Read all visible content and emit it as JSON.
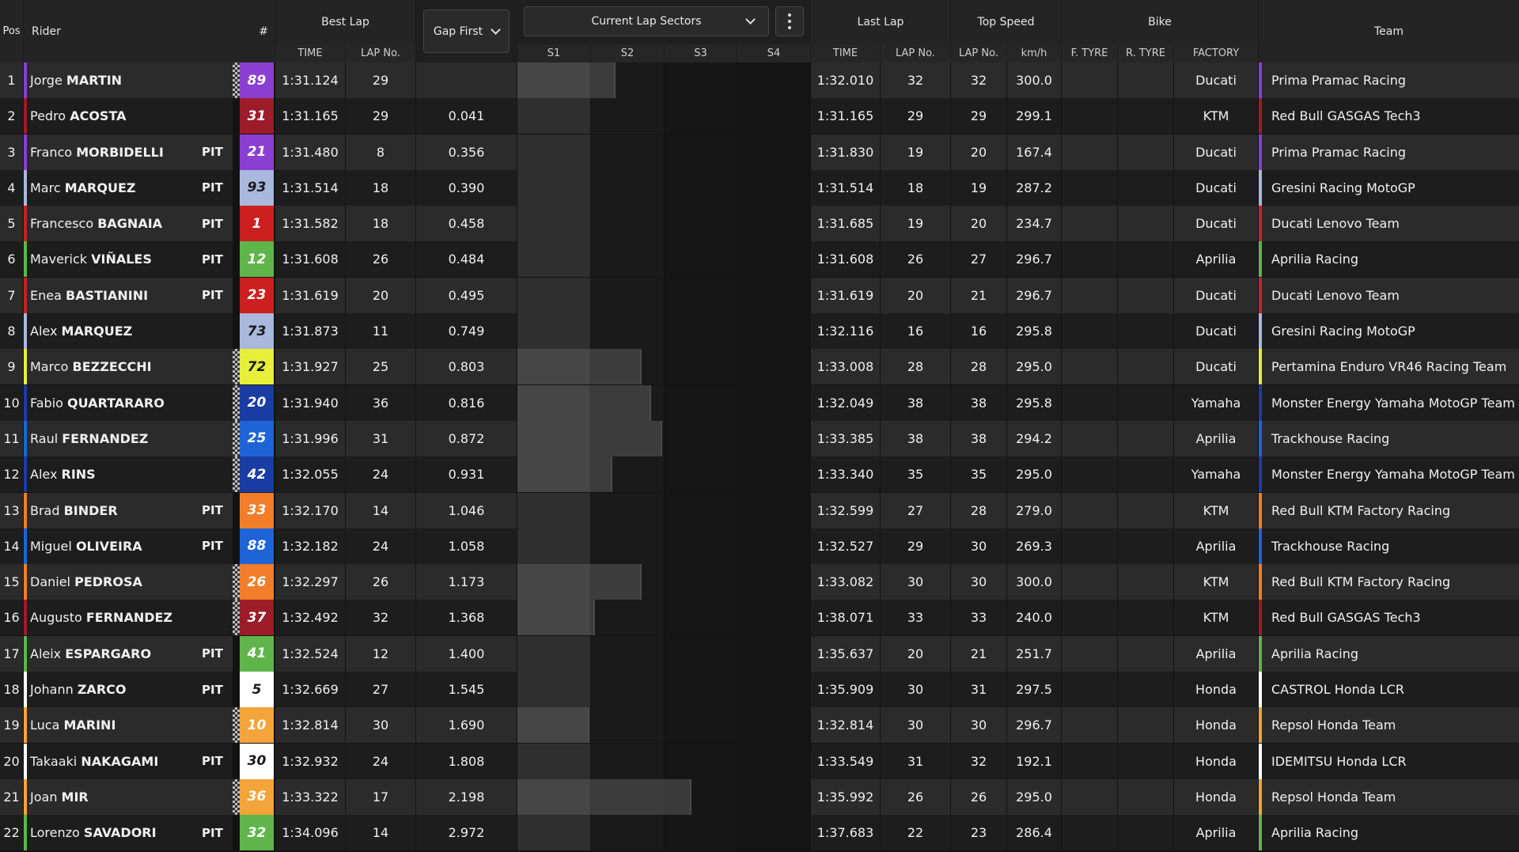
{
  "header": {
    "pos": "Pos",
    "rider": "Rider",
    "number": "#",
    "best_lap": "Best Lap",
    "best_time": "TIME",
    "best_lap_no": "LAP No.",
    "gap_select": "Gap First",
    "sectors_select": "Current Lap Sectors",
    "s1": "S1",
    "s2": "S2",
    "s3": "S3",
    "s4": "S4",
    "last_lap": "Last Lap",
    "last_time": "TIME",
    "last_lap_no": "LAP No.",
    "top_speed": "Top Speed",
    "ts_lap_no": "LAP No.",
    "ts_kmh": "km/h",
    "bike": "Bike",
    "f_tyre": "F. TYRE",
    "r_tyre": "R. TYRE",
    "factory": "FACTORY",
    "team": "Team"
  },
  "riders": [
    {
      "pos": "1",
      "first": "Jorge",
      "last": "MARTIN",
      "pit": "",
      "num": "89",
      "num_bg": "#8a3fd1",
      "num_fg": "#ffffff",
      "flag": true,
      "best_time": "1:31.124",
      "best_lap": "29",
      "gap": "",
      "last_time": "1:32.010",
      "last_lap": "32",
      "ts_lap": "32",
      "ts_kmh": "300.0",
      "factory": "Ducati",
      "team": "Prima Pramac Racing",
      "team_color": "#8a3fd1",
      "sector_progress": 0.33
    },
    {
      "pos": "2",
      "first": "Pedro",
      "last": "ACOSTA",
      "pit": "",
      "num": "31",
      "num_bg": "#9c1c2a",
      "num_fg": "#ffffff",
      "flag": false,
      "best_time": "1:31.165",
      "best_lap": "29",
      "gap": "0.041",
      "last_time": "1:31.165",
      "last_lap": "29",
      "ts_lap": "29",
      "ts_kmh": "299.1",
      "factory": "KTM",
      "team": "Red Bull GASGAS Tech3",
      "team_color": "#9c1c2a",
      "sector_progress": 0
    },
    {
      "pos": "3",
      "first": "Franco",
      "last": "MORBIDELLI",
      "pit": "PIT",
      "num": "21",
      "num_bg": "#8a3fd1",
      "num_fg": "#ffffff",
      "flag": false,
      "best_time": "1:31.480",
      "best_lap": "8",
      "gap": "0.356",
      "last_time": "1:31.830",
      "last_lap": "19",
      "ts_lap": "20",
      "ts_kmh": "167.4",
      "factory": "Ducati",
      "team": "Prima Pramac Racing",
      "team_color": "#8a3fd1",
      "sector_progress": 0
    },
    {
      "pos": "4",
      "first": "Marc",
      "last": "MARQUEZ",
      "pit": "PIT",
      "num": "93",
      "num_bg": "#a9b8dc",
      "num_fg": "#1a1a1a",
      "flag": false,
      "best_time": "1:31.514",
      "best_lap": "18",
      "gap": "0.390",
      "last_time": "1:31.514",
      "last_lap": "18",
      "ts_lap": "19",
      "ts_kmh": "287.2",
      "factory": "Ducati",
      "team": "Gresini Racing MotoGP",
      "team_color": "#a9b8dc",
      "sector_progress": 0
    },
    {
      "pos": "5",
      "first": "Francesco",
      "last": "BAGNAIA",
      "pit": "PIT",
      "num": "1",
      "num_bg": "#cc1f1f",
      "num_fg": "#ffffff",
      "flag": false,
      "best_time": "1:31.582",
      "best_lap": "18",
      "gap": "0.458",
      "last_time": "1:31.685",
      "last_lap": "19",
      "ts_lap": "20",
      "ts_kmh": "234.7",
      "factory": "Ducati",
      "team": "Ducati Lenovo Team",
      "team_color": "#cc1f1f",
      "sector_progress": 0
    },
    {
      "pos": "6",
      "first": "Maverick",
      "last": "VIÑALES",
      "pit": "PIT",
      "num": "12",
      "num_bg": "#5fb54a",
      "num_fg": "#ffffff",
      "flag": false,
      "best_time": "1:31.608",
      "best_lap": "26",
      "gap": "0.484",
      "last_time": "1:31.608",
      "last_lap": "26",
      "ts_lap": "27",
      "ts_kmh": "296.7",
      "factory": "Aprilia",
      "team": "Aprilia Racing",
      "team_color": "#5fb54a",
      "sector_progress": 0
    },
    {
      "pos": "7",
      "first": "Enea",
      "last": "BASTIANINI",
      "pit": "PIT",
      "num": "23",
      "num_bg": "#cc1f1f",
      "num_fg": "#ffffff",
      "flag": false,
      "best_time": "1:31.619",
      "best_lap": "20",
      "gap": "0.495",
      "last_time": "1:31.619",
      "last_lap": "20",
      "ts_lap": "21",
      "ts_kmh": "296.7",
      "factory": "Ducati",
      "team": "Ducati Lenovo Team",
      "team_color": "#cc1f1f",
      "sector_progress": 0
    },
    {
      "pos": "8",
      "first": "Alex",
      "last": "MARQUEZ",
      "pit": "",
      "num": "73",
      "num_bg": "#a9b8dc",
      "num_fg": "#1a1a1a",
      "flag": false,
      "best_time": "1:31.873",
      "best_lap": "11",
      "gap": "0.749",
      "last_time": "1:32.116",
      "last_lap": "16",
      "ts_lap": "16",
      "ts_kmh": "295.8",
      "factory": "Ducati",
      "team": "Gresini Racing MotoGP",
      "team_color": "#a9b8dc",
      "sector_progress": 0
    },
    {
      "pos": "9",
      "first": "Marco",
      "last": "BEZZECCHI",
      "pit": "",
      "num": "72",
      "num_bg": "#e6ef3a",
      "num_fg": "#1a1a1a",
      "flag": true,
      "best_time": "1:31.927",
      "best_lap": "25",
      "gap": "0.803",
      "last_time": "1:33.008",
      "last_lap": "28",
      "ts_lap": "28",
      "ts_kmh": "295.0",
      "factory": "Ducati",
      "team": "Pertamina Enduro VR46 Racing Team",
      "team_color": "#e6ef3a",
      "sector_progress": 0.42
    },
    {
      "pos": "10",
      "first": "Fabio",
      "last": "QUARTARARO",
      "pit": "",
      "num": "20",
      "num_bg": "#1a3da3",
      "num_fg": "#ffffff",
      "flag": true,
      "best_time": "1:31.940",
      "best_lap": "36",
      "gap": "0.816",
      "last_time": "1:32.049",
      "last_lap": "38",
      "ts_lap": "38",
      "ts_kmh": "295.8",
      "factory": "Yamaha",
      "team": "Monster Energy Yamaha MotoGP Team",
      "team_color": "#1a3da3",
      "sector_progress": 0.45
    },
    {
      "pos": "11",
      "first": "Raul",
      "last": "FERNANDEZ",
      "pit": "",
      "num": "25",
      "num_bg": "#1f64d6",
      "num_fg": "#ffffff",
      "flag": true,
      "best_time": "1:31.996",
      "best_lap": "31",
      "gap": "0.872",
      "last_time": "1:33.385",
      "last_lap": "38",
      "ts_lap": "38",
      "ts_kmh": "294.2",
      "factory": "Aprilia",
      "team": "Trackhouse Racing",
      "team_color": "#1f64d6",
      "sector_progress": 0.49
    },
    {
      "pos": "12",
      "first": "Alex",
      "last": "RINS",
      "pit": "",
      "num": "42",
      "num_bg": "#1a3da3",
      "num_fg": "#ffffff",
      "flag": true,
      "best_time": "1:32.055",
      "best_lap": "24",
      "gap": "0.931",
      "last_time": "1:33.340",
      "last_lap": "35",
      "ts_lap": "35",
      "ts_kmh": "295.0",
      "factory": "Yamaha",
      "team": "Monster Energy Yamaha MotoGP Team",
      "team_color": "#1a3da3",
      "sector_progress": 0.32
    },
    {
      "pos": "13",
      "first": "Brad",
      "last": "BINDER",
      "pit": "PIT",
      "num": "33",
      "num_bg": "#f07e2a",
      "num_fg": "#ffffff",
      "flag": false,
      "best_time": "1:32.170",
      "best_lap": "14",
      "gap": "1.046",
      "last_time": "1:32.599",
      "last_lap": "27",
      "ts_lap": "28",
      "ts_kmh": "279.0",
      "factory": "KTM",
      "team": "Red Bull KTM Factory Racing",
      "team_color": "#f07e2a",
      "sector_progress": 0
    },
    {
      "pos": "14",
      "first": "Miguel",
      "last": "OLIVEIRA",
      "pit": "PIT",
      "num": "88",
      "num_bg": "#1f64d6",
      "num_fg": "#ffffff",
      "flag": false,
      "best_time": "1:32.182",
      "best_lap": "24",
      "gap": "1.058",
      "last_time": "1:32.527",
      "last_lap": "29",
      "ts_lap": "30",
      "ts_kmh": "269.3",
      "factory": "Aprilia",
      "team": "Trackhouse Racing",
      "team_color": "#1f64d6",
      "sector_progress": 0
    },
    {
      "pos": "15",
      "first": "Daniel",
      "last": "PEDROSA",
      "pit": "",
      "num": "26",
      "num_bg": "#f07e2a",
      "num_fg": "#ffffff",
      "flag": true,
      "best_time": "1:32.297",
      "best_lap": "26",
      "gap": "1.173",
      "last_time": "1:33.082",
      "last_lap": "30",
      "ts_lap": "30",
      "ts_kmh": "300.0",
      "factory": "KTM",
      "team": "Red Bull KTM Factory Racing",
      "team_color": "#f07e2a",
      "sector_progress": 0.42
    },
    {
      "pos": "16",
      "first": "Augusto",
      "last": "FERNANDEZ",
      "pit": "",
      "num": "37",
      "num_bg": "#9c1c2a",
      "num_fg": "#ffffff",
      "flag": true,
      "best_time": "1:32.492",
      "best_lap": "32",
      "gap": "1.368",
      "last_time": "1:38.071",
      "last_lap": "33",
      "ts_lap": "33",
      "ts_kmh": "240.0",
      "factory": "KTM",
      "team": "Red Bull GASGAS Tech3",
      "team_color": "#9c1c2a",
      "sector_progress": 0.26
    },
    {
      "pos": "17",
      "first": "Aleix",
      "last": "ESPARGARO",
      "pit": "PIT",
      "num": "41",
      "num_bg": "#5fb54a",
      "num_fg": "#ffffff",
      "flag": false,
      "best_time": "1:32.524",
      "best_lap": "12",
      "gap": "1.400",
      "last_time": "1:35.637",
      "last_lap": "20",
      "ts_lap": "21",
      "ts_kmh": "251.7",
      "factory": "Aprilia",
      "team": "Aprilia Racing",
      "team_color": "#5fb54a",
      "sector_progress": 0
    },
    {
      "pos": "18",
      "first": "Johann",
      "last": "ZARCO",
      "pit": "PIT",
      "num": "5",
      "num_bg": "#ffffff",
      "num_fg": "#1a1a1a",
      "flag": false,
      "best_time": "1:32.669",
      "best_lap": "27",
      "gap": "1.545",
      "last_time": "1:35.909",
      "last_lap": "30",
      "ts_lap": "31",
      "ts_kmh": "297.5",
      "factory": "Honda",
      "team": "CASTROL Honda LCR",
      "team_color": "#ffffff",
      "sector_progress": 0
    },
    {
      "pos": "19",
      "first": "Luca",
      "last": "MARINI",
      "pit": "",
      "num": "10",
      "num_bg": "#f3a43a",
      "num_fg": "#ffffff",
      "flag": true,
      "best_time": "1:32.814",
      "best_lap": "30",
      "gap": "1.690",
      "last_time": "1:32.814",
      "last_lap": "30",
      "ts_lap": "30",
      "ts_kmh": "296.7",
      "factory": "Honda",
      "team": "Repsol Honda Team",
      "team_color": "#f3a43a",
      "sector_progress": 0.24
    },
    {
      "pos": "20",
      "first": "Takaaki",
      "last": "NAKAGAMI",
      "pit": "PIT",
      "num": "30",
      "num_bg": "#ffffff",
      "num_fg": "#1a1a1a",
      "flag": false,
      "best_time": "1:32.932",
      "best_lap": "24",
      "gap": "1.808",
      "last_time": "1:33.549",
      "last_lap": "31",
      "ts_lap": "32",
      "ts_kmh": "192.1",
      "factory": "Honda",
      "team": "IDEMITSU Honda LCR",
      "team_color": "#ffffff",
      "sector_progress": 0
    },
    {
      "pos": "21",
      "first": "Joan",
      "last": "MIR",
      "pit": "",
      "num": "36",
      "num_bg": "#f3a43a",
      "num_fg": "#ffffff",
      "flag": true,
      "best_time": "1:33.322",
      "best_lap": "17",
      "gap": "2.198",
      "last_time": "1:35.992",
      "last_lap": "26",
      "ts_lap": "26",
      "ts_kmh": "295.0",
      "factory": "Honda",
      "team": "Repsol Honda Team",
      "team_color": "#f3a43a",
      "sector_progress": 0.59
    },
    {
      "pos": "22",
      "first": "Lorenzo",
      "last": "SAVADORI",
      "pit": "PIT",
      "num": "32",
      "num_bg": "#5fb54a",
      "num_fg": "#ffffff",
      "flag": false,
      "best_time": "1:34.096",
      "best_lap": "14",
      "gap": "2.972",
      "last_time": "1:37.683",
      "last_lap": "22",
      "ts_lap": "23",
      "ts_kmh": "286.4",
      "factory": "Aprilia",
      "team": "Aprilia Racing",
      "team_color": "#5fb54a",
      "sector_progress": 0
    }
  ]
}
